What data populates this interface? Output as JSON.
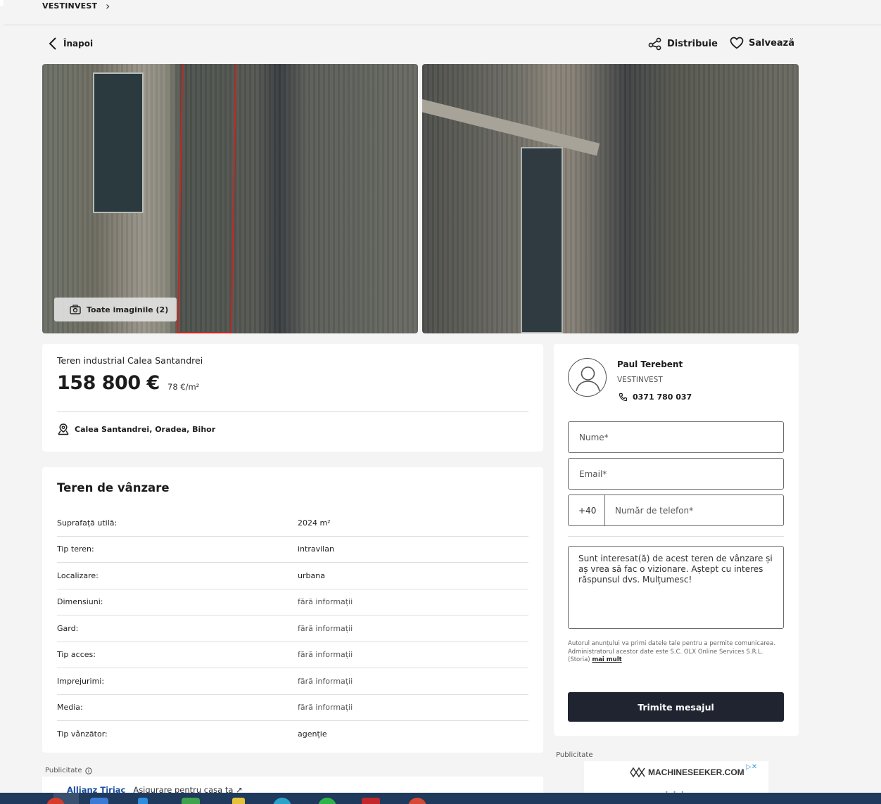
{
  "breadcrumb": {
    "label": "VESTINVEST"
  },
  "nav": {
    "back_label": "Înapoi",
    "share_label": "Distribuie",
    "save_label": "Salvează"
  },
  "gallery": {
    "all_photos_label": "Toate imaginile (2)"
  },
  "listing": {
    "title": "Teren industrial Calea Santandrei",
    "price": "158 800 €",
    "price_per_sqm": "78 €/m²",
    "location": "Calea Santandrei, Oradea, Bihor"
  },
  "details": {
    "heading": "Teren de vânzare",
    "rows": [
      {
        "label": "Suprafață utilă:",
        "value": "2024 m²"
      },
      {
        "label": "Tip teren:",
        "value": "intravilan"
      },
      {
        "label": "Localizare:",
        "value": "urbana"
      },
      {
        "label": "Dimensiuni:",
        "value": "fără informații"
      },
      {
        "label": "Gard:",
        "value": "fără informații"
      },
      {
        "label": "Tip acces:",
        "value": "fără informații"
      },
      {
        "label": "Imprejurimi:",
        "value": "fără informații"
      },
      {
        "label": "Media:",
        "value": "fără informații"
      },
      {
        "label": "Tip vânzător:",
        "value": "agenție"
      }
    ]
  },
  "contact": {
    "agent_name": "Paul Terebent",
    "agency": "VESTINVEST",
    "phone": "0371 780 037",
    "name_placeholder": "Nume*",
    "email_placeholder": "Email*",
    "phone_prefix": "+40",
    "phone_placeholder": "Număr de telefon*",
    "message": "Sunt interesat(ă) de acest teren de vânzare și aș vrea să fac o vizionare. Aștept cu interes răspunsul dvs. Mulțumesc!",
    "disclaimer_1": "Autorul anunțului va primi datele tale pentru a permite comunicarea.",
    "disclaimer_2": "Administratorul acestor date este S.C. OLX Online Services S.R.L. (Storia)",
    "more_link": "mai mult",
    "send_label": "Trimite mesajul"
  },
  "ads": {
    "main_label": "Publicitate",
    "main_brand": "Allianz Țiriac",
    "main_text": "Asigurare pentru casa ta",
    "side_label": "Publicitate",
    "side_brand": "MACHINESEEKER.COM"
  }
}
